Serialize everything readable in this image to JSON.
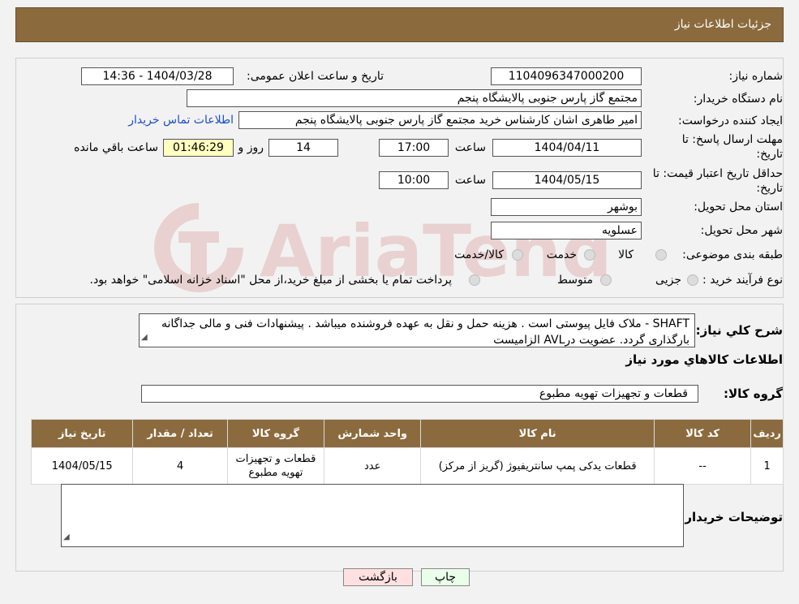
{
  "header": {
    "title": "جزئیات اطلاعات نیاز"
  },
  "form": {
    "need_number_label": "شماره نیاز:",
    "need_number": "1104096347000200",
    "announce_label": "تاریخ و ساعت اعلان عمومی:",
    "announce_value": "1404/03/28 - 14:36",
    "buyer_org_label": "نام دستگاه خریدار:",
    "buyer_org": "مجتمع گاز پارس جنوبی  پالایشگاه پنجم",
    "requester_label": "ایجاد کننده درخواست:",
    "requester": "امیر طاهری اشان کارشناس خرید مجتمع گاز پارس جنوبی  پالایشگاه پنجم",
    "contact_link": "اطلاعات تماس خریدار",
    "deadline_label_1": "مهلت ارسال پاسخ: تا",
    "deadline_label_2": "تاریخ:",
    "deadline_date": "1404/04/11",
    "time_label": "ساعت",
    "deadline_time": "17:00",
    "days_value": "14",
    "days_label": "روز و",
    "remaining_time": "01:46:29",
    "remaining_label": "ساعت باقي مانده",
    "validity_label_1": "حداقل تاریخ اعتبار قیمت: تا",
    "validity_label_2": "تاریخ:",
    "validity_date": "1404/05/15",
    "validity_time": "10:00",
    "province_label": "استان محل تحویل:",
    "province": "بوشهر",
    "city_label": "شهر محل تحویل:",
    "city": "عسلویه",
    "category_label": "طبقه بندی موضوعی:",
    "category_options": [
      "کالا",
      "خدمت",
      "کالا/خدمت"
    ],
    "process_label": "نوع فرآیند خرید :",
    "process_options": [
      "جزیی",
      "متوسط"
    ],
    "process_note": "پرداخت تمام یا بخشی از مبلغ خرید،از محل \"اسناد خزانه اسلامی\" خواهد بود."
  },
  "description": {
    "label": "شرح کلي نياز:",
    "text": "SHAFT - ملاک فایل پیوستی است . هزینه حمل و نقل به عهده فروشنده میباشد . پیشنهادات فنی و مالی جداگانه بارگذاری گردد. عضویت درAVL الزامیست"
  },
  "goods_section": {
    "title": "اطلاعات كالاهاي مورد نياز",
    "group_label": "گروه کالا:",
    "group_value": "قطعات و تجهیزات تهویه مطبوع"
  },
  "table": {
    "headers": [
      "ردیف",
      "کد کالا",
      "نام کالا",
      "واحد شمارش",
      "گروه کالا",
      "تعداد / مقدار",
      "تاریخ نیاز"
    ],
    "rows": [
      {
        "row": "1",
        "code": "--",
        "name": "قطعات یدکی پمپ سانتریفیوژ (گریز از مرکز)",
        "unit": "عدد",
        "group": "قطعات و تجهیزات تهویه مطبوع",
        "qty": "4",
        "date": "1404/05/15"
      }
    ]
  },
  "buyer_notes": {
    "label": "توضیحات خریدار:",
    "value": ""
  },
  "buttons": {
    "print": "چاپ",
    "back": "بازگشت"
  },
  "watermark": {
    "text": "AriaTender.neT"
  }
}
